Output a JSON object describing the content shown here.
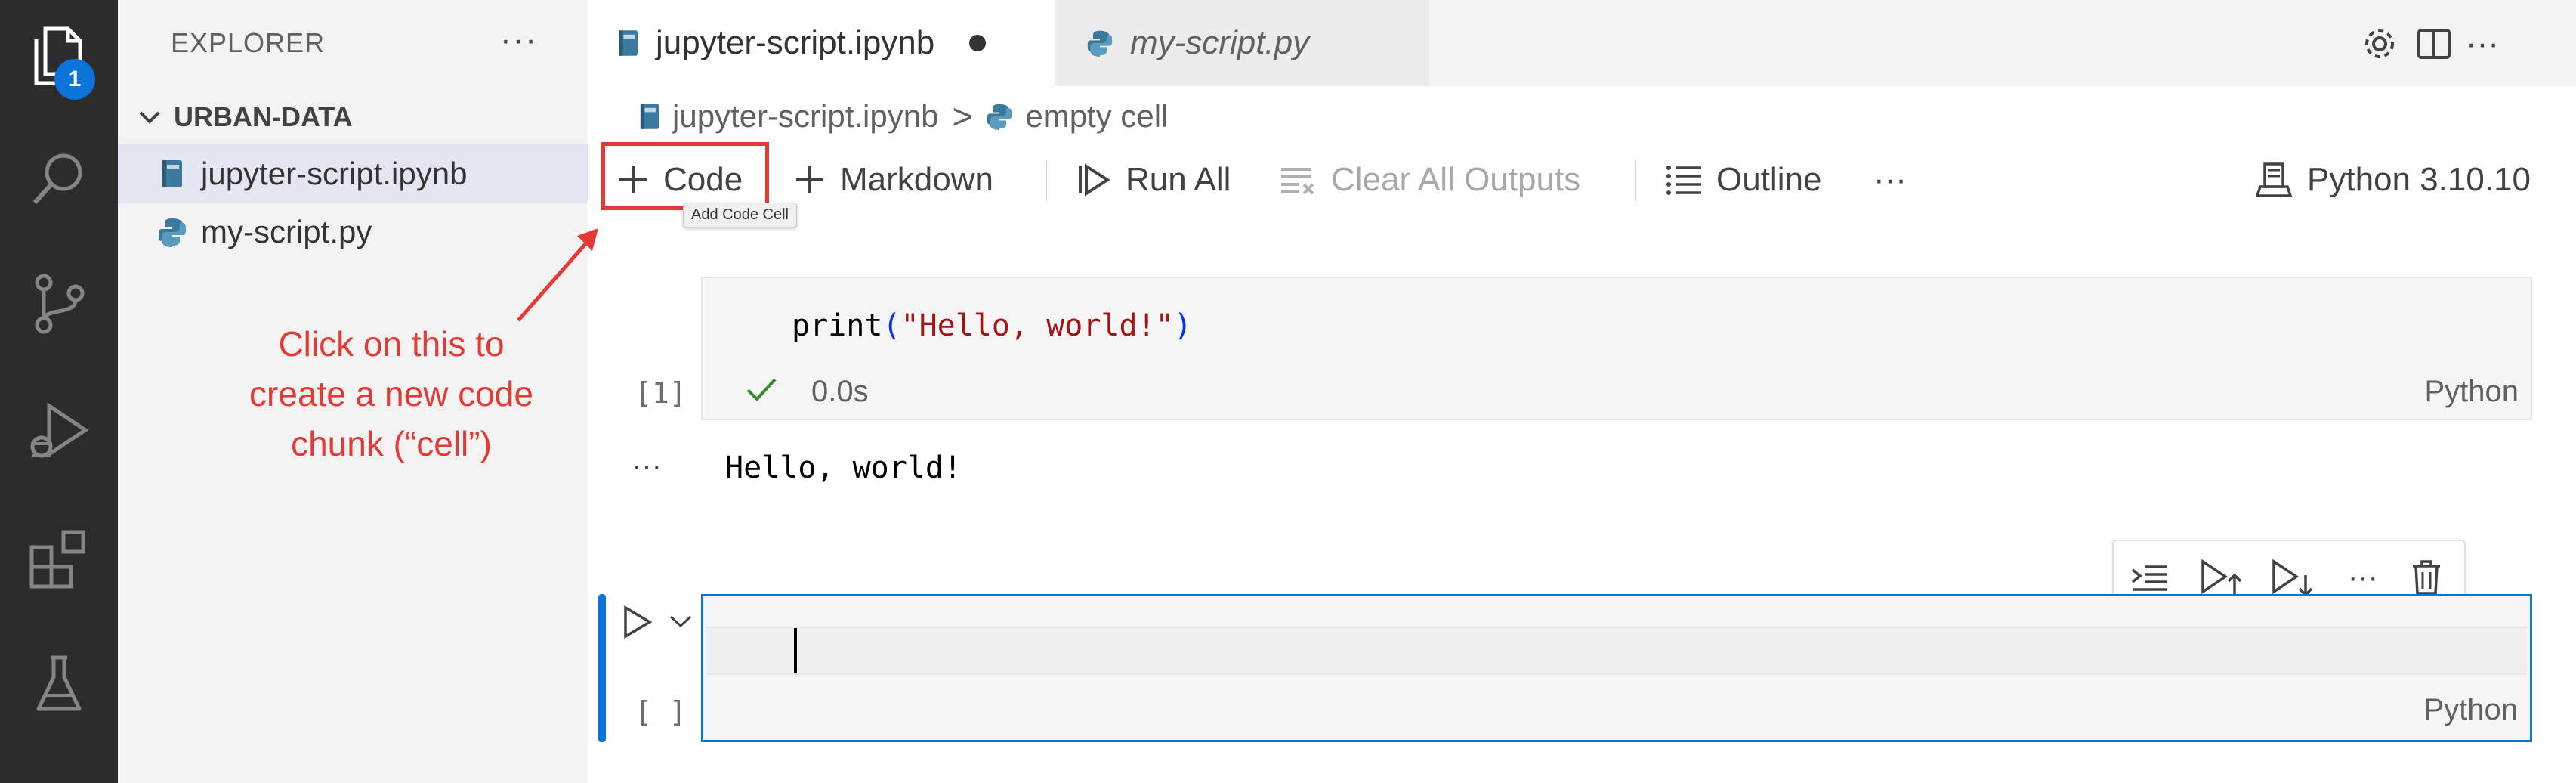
{
  "activity_bar": {
    "explorer_badge": "1",
    "icons": [
      "files-icon",
      "search-icon",
      "source-control-icon",
      "run-debug-icon",
      "extensions-icon",
      "testing-icon"
    ]
  },
  "sidebar": {
    "title": "EXPLORER",
    "more": "···",
    "folder": "URBAN-DATA",
    "files": [
      {
        "label": "jupyter-script.ipynb",
        "icon": "notebook-icon",
        "active": true
      },
      {
        "label": "my-script.py",
        "icon": "python-icon",
        "active": false
      }
    ]
  },
  "tabs": [
    {
      "label": "jupyter-script.ipynb",
      "active": true,
      "dirty": true
    },
    {
      "label": "my-script.py",
      "active": false,
      "italic": true
    }
  ],
  "breadcrumb": {
    "file": "jupyter-script.ipynb",
    "separator": ">",
    "item": "empty cell"
  },
  "toolbar": {
    "code": "Code",
    "markdown": "Markdown",
    "run_all": "Run All",
    "clear_outputs": "Clear All Outputs",
    "outline": "Outline",
    "more": "···",
    "kernel": "Python 3.10.10",
    "tooltip": "Add Code Cell"
  },
  "annotation": {
    "lines": [
      "Click on this to",
      "create a new code",
      "chunk (“cell”)"
    ]
  },
  "cells": [
    {
      "code_func": "print",
      "code_open": "(",
      "code_string": "\"Hello, world!\"",
      "code_close": ")",
      "exec_count": "[1]",
      "time": "0.0s",
      "language": "Python",
      "output": "Hello, world!",
      "output_more": "···"
    },
    {
      "exec_count": "[ ]",
      "language": "Python"
    }
  ],
  "colors": {
    "accent": "#0a74d8",
    "annotation": "#e53935",
    "string": "#a31515",
    "success": "#388a34"
  }
}
